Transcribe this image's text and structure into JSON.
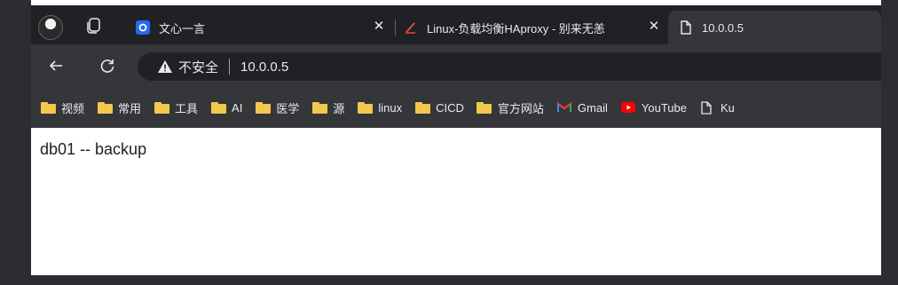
{
  "tabs": [
    {
      "title": "文心一言",
      "icon": "baidu-ernie-icon",
      "active": false
    },
    {
      "title": "Linux-负载均衡HAproxy - 别来无恙",
      "icon": "pen-icon",
      "active": false
    },
    {
      "title": "10.0.0.5",
      "icon": "page-icon",
      "active": true
    }
  ],
  "toolbar": {
    "security_label": "不安全",
    "url": "10.0.0.5"
  },
  "bookmarks": [
    {
      "label": "视频",
      "icon": "folder-icon"
    },
    {
      "label": "常用",
      "icon": "folder-icon"
    },
    {
      "label": "工具",
      "icon": "folder-icon"
    },
    {
      "label": "AI",
      "icon": "folder-icon"
    },
    {
      "label": "医学",
      "icon": "folder-icon"
    },
    {
      "label": "源",
      "icon": "folder-icon"
    },
    {
      "label": "linux",
      "icon": "folder-icon"
    },
    {
      "label": "CICD",
      "icon": "folder-icon"
    },
    {
      "label": "官方网站",
      "icon": "folder-icon"
    },
    {
      "label": "Gmail",
      "icon": "gmail-icon"
    },
    {
      "label": "YouTube",
      "icon": "youtube-icon"
    },
    {
      "label": "Ku",
      "icon": "page-icon"
    }
  ],
  "page": {
    "text": "db01 -- backup"
  },
  "colors": {
    "chrome_dark": "#202124",
    "toolbar": "#35363a",
    "folder": "#f2c94c",
    "page_bg": "#ffffff"
  }
}
